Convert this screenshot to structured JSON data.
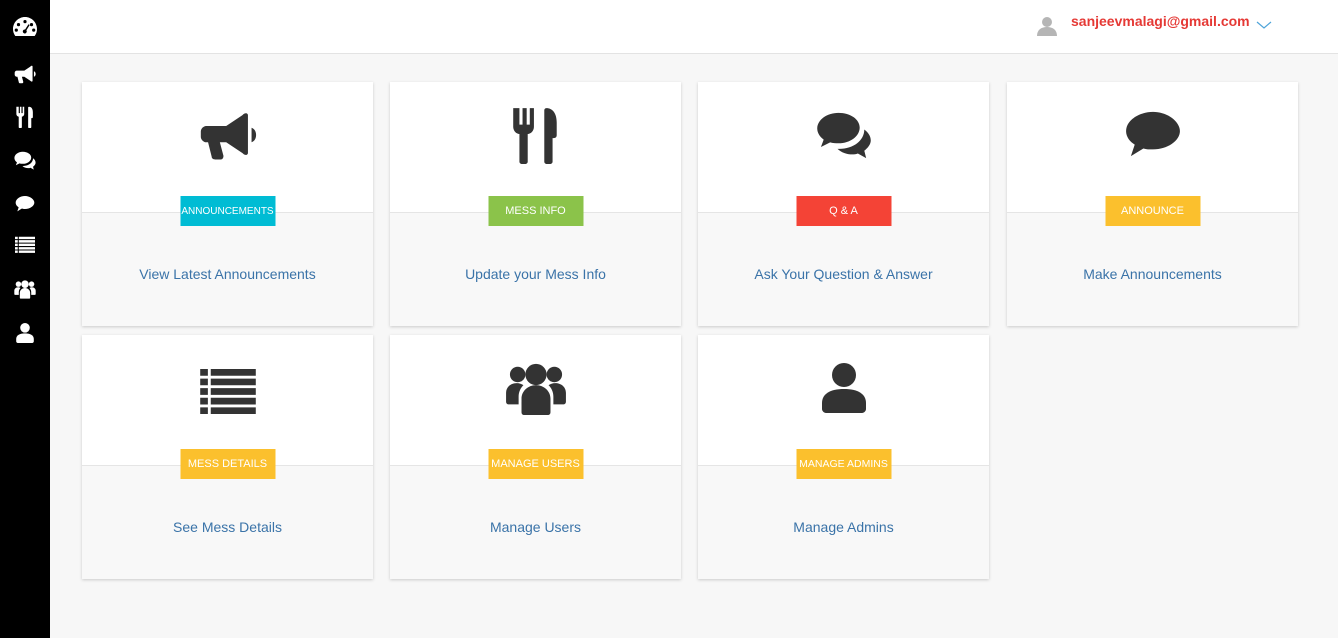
{
  "header": {
    "user_email": "sanjeevmalagi@gmail.com"
  },
  "sidebar": {
    "items": [
      {
        "icon": "dashboard-icon"
      },
      {
        "icon": "bullhorn-icon"
      },
      {
        "icon": "cutlery-icon"
      },
      {
        "icon": "comments-icon"
      },
      {
        "icon": "comment-icon"
      },
      {
        "icon": "list-icon"
      },
      {
        "icon": "users-icon"
      },
      {
        "icon": "user-icon"
      }
    ]
  },
  "cards": [
    {
      "icon": "bullhorn-icon",
      "badge": "ANNOUNCEMENTS",
      "badge_color": "#00bcd4",
      "link": "View Latest Announcements"
    },
    {
      "icon": "cutlery-icon",
      "badge": "MESS INFO",
      "badge_color": "#8bc34a",
      "link": "Update your Mess Info"
    },
    {
      "icon": "comments-icon",
      "badge": "Q & A",
      "badge_color": "#f44336",
      "link": "Ask Your Question & Answer"
    },
    {
      "icon": "comment-icon",
      "badge": "ANNOUNCE",
      "badge_color": "#fbc02d",
      "link": "Make Announcements"
    },
    {
      "icon": "list-icon",
      "badge": "MESS DETAILS",
      "badge_color": "#fbc02d",
      "link": "See Mess Details"
    },
    {
      "icon": "users-icon",
      "badge": "MANAGE USERS",
      "badge_color": "#fbc02d",
      "link": "Manage Users"
    },
    {
      "icon": "user-icon",
      "badge": "MANAGE ADMINS",
      "badge_color": "#fbc02d",
      "link": "Manage Admins"
    }
  ]
}
